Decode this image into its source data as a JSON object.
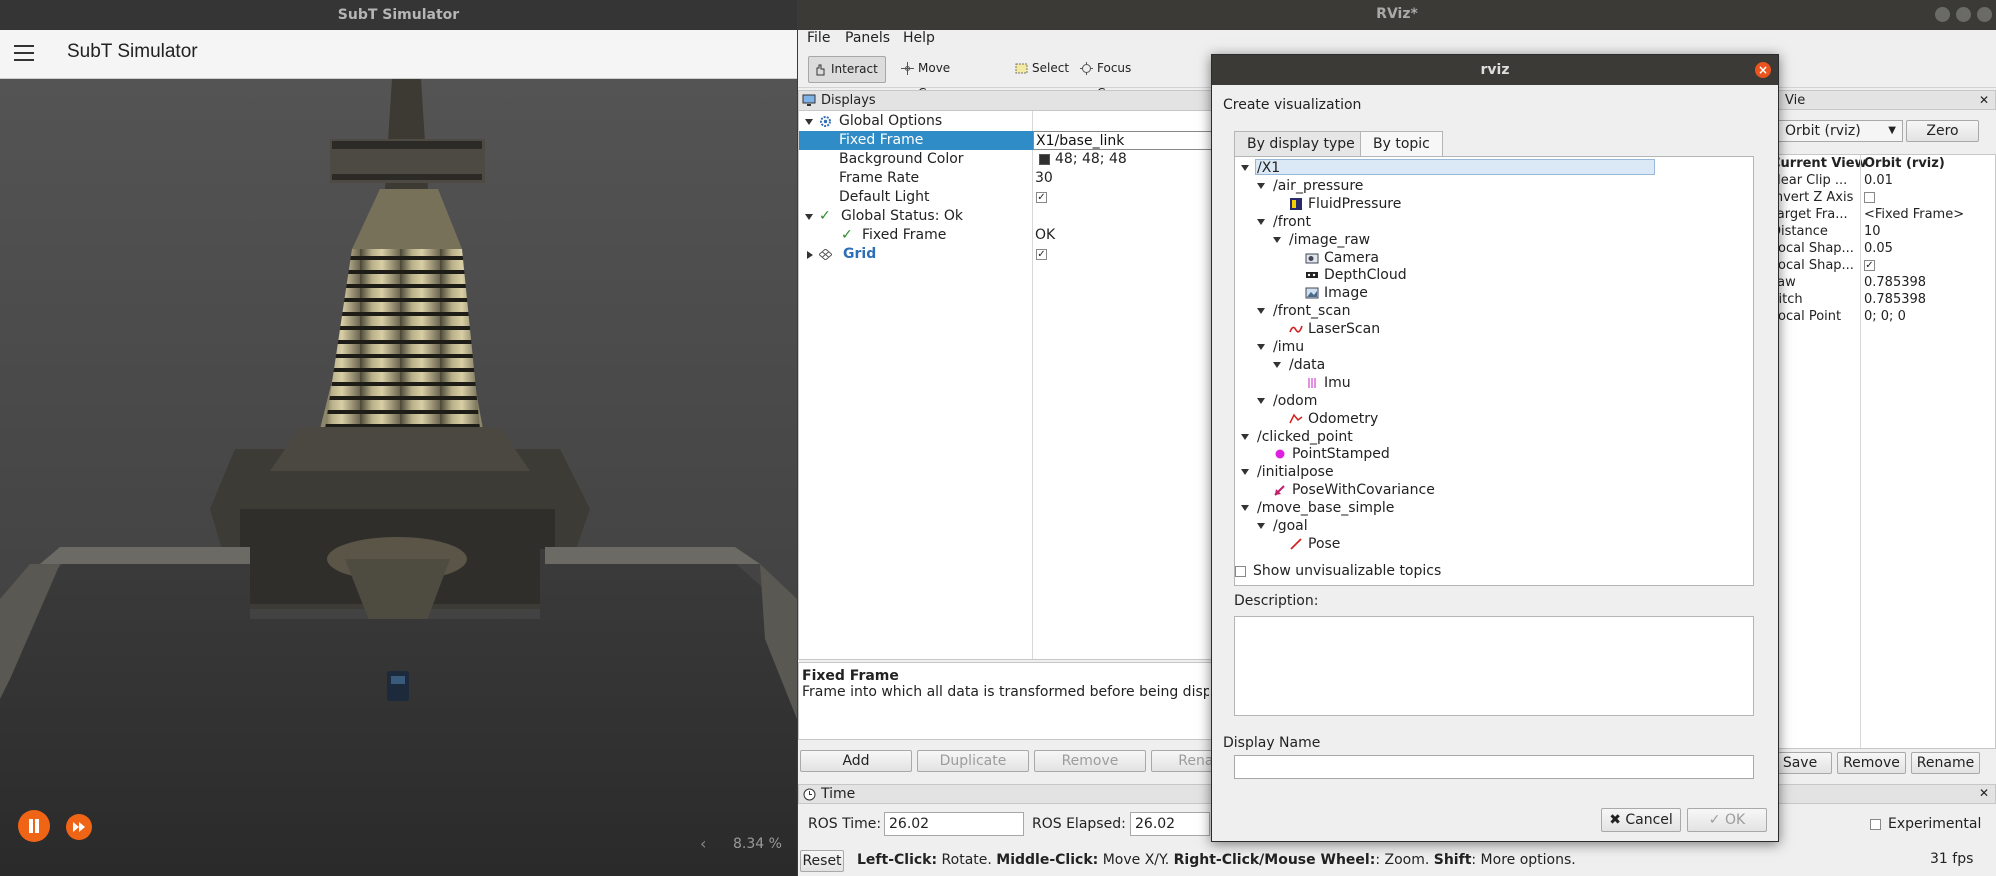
{
  "subt": {
    "window_title": "SubT Simulator",
    "app_title": "SubT Simulator",
    "zoom": "8.34 %",
    "zoom_chevron": "‹",
    "play_icon": "pause-icon",
    "ff_icon": "fast-forward-icon",
    "accent": "#f06416"
  },
  "rviz": {
    "window_title": "RViz*",
    "menu": [
      "File",
      "Panels",
      "Help"
    ],
    "toolbar": [
      "Interact",
      "Move Camera",
      "Select",
      "Focus Camera"
    ],
    "displays": {
      "title": "Displays",
      "rows": [
        {
          "label": "Global Options",
          "value": ""
        },
        {
          "label": "Fixed Frame",
          "value": "X1/base_link"
        },
        {
          "label": "Background Color",
          "value": "48; 48; 48"
        },
        {
          "label": "Frame Rate",
          "value": "30"
        },
        {
          "label": "Default Light",
          "value": "✓"
        },
        {
          "label": "Global Status: Ok",
          "value": ""
        },
        {
          "label": "Fixed Frame",
          "value": "OK"
        },
        {
          "label": "Grid",
          "value": "✓"
        }
      ]
    },
    "description": {
      "title": "Fixed Frame",
      "text": "Frame into which all data is transformed before being displayed."
    },
    "buttons": {
      "add": "Add",
      "duplicate": "Duplicate",
      "remove": "Remove",
      "rename": "Rename"
    },
    "views": {
      "title": "Views",
      "type": "Orbit (rviz)",
      "zero": "Zero",
      "header": {
        "k": "Current View",
        "v": "Orbit (rviz)"
      },
      "rows": [
        {
          "k": "Near Clip ...",
          "v": "0.01"
        },
        {
          "k": "Invert Z Axis",
          "v": ""
        },
        {
          "k": "Target Fra...",
          "v": "<Fixed Frame>"
        },
        {
          "k": "Distance",
          "v": "10"
        },
        {
          "k": "Focal Shap...",
          "v": "0.05"
        },
        {
          "k": "Focal Shap...",
          "v": "✓"
        },
        {
          "k": "Yaw",
          "v": "0.785398"
        },
        {
          "k": "Pitch",
          "v": "0.785398"
        },
        {
          "k": "Focal Point",
          "v": "0; 0; 0"
        }
      ],
      "buttons": {
        "save": "Save",
        "remove": "Remove",
        "rename": "Rename"
      }
    },
    "time": {
      "title": "Time",
      "ros_time_label": "ROS Time:",
      "ros_time": "26.02",
      "ros_elapsed_label": "ROS Elapsed:",
      "ros_elapsed": "26.02",
      "experimental": "Experimental",
      "reset": "Reset",
      "help_left_click": "Left-Click:",
      "help_rotate": " Rotate. ",
      "help_middle": "Middle-Click:",
      "help_move": " Move X/Y. ",
      "help_right": "Right-Click/Mouse Wheel:",
      "help_zoom": ": Zoom. ",
      "help_shift": "Shift",
      "help_more": ": More options.",
      "fps": "31 fps"
    }
  },
  "dialog": {
    "title": "rviz",
    "heading": "Create visualization",
    "tabs": [
      "By display type",
      "By topic"
    ],
    "tree": [
      {
        "depth": 0,
        "label": "/X1",
        "kind": "topic",
        "expanded": true
      },
      {
        "depth": 1,
        "label": "/air_pressure",
        "kind": "topic",
        "expanded": true
      },
      {
        "depth": 2,
        "label": "FluidPressure",
        "kind": "display",
        "icon": "fluid-pressure-icon"
      },
      {
        "depth": 1,
        "label": "/front",
        "kind": "topic",
        "expanded": true
      },
      {
        "depth": 2,
        "label": "/image_raw",
        "kind": "topic",
        "expanded": true
      },
      {
        "depth": 3,
        "label": "Camera",
        "kind": "display",
        "icon": "camera-icon"
      },
      {
        "depth": 3,
        "label": "DepthCloud",
        "kind": "display",
        "icon": "depth-cloud-icon"
      },
      {
        "depth": 3,
        "label": "Image",
        "kind": "display",
        "icon": "image-icon"
      },
      {
        "depth": 1,
        "label": "/front_scan",
        "kind": "topic",
        "expanded": true
      },
      {
        "depth": 2,
        "label": "LaserScan",
        "kind": "display",
        "icon": "laser-scan-icon"
      },
      {
        "depth": 1,
        "label": "/imu",
        "kind": "topic",
        "expanded": true
      },
      {
        "depth": 2,
        "label": "/data",
        "kind": "topic",
        "expanded": true
      },
      {
        "depth": 3,
        "label": "Imu",
        "kind": "display",
        "icon": "imu-icon"
      },
      {
        "depth": 1,
        "label": "/odom",
        "kind": "topic",
        "expanded": true
      },
      {
        "depth": 2,
        "label": "Odometry",
        "kind": "display",
        "icon": "odometry-icon"
      },
      {
        "depth": 0,
        "label": "/clicked_point",
        "kind": "topic",
        "expanded": true
      },
      {
        "depth": 1,
        "label": "PointStamped",
        "kind": "display",
        "icon": "point-stamped-icon"
      },
      {
        "depth": 0,
        "label": "/initialpose",
        "kind": "topic",
        "expanded": true
      },
      {
        "depth": 1,
        "label": "PoseWithCovariance",
        "kind": "display",
        "icon": "pose-covariance-icon"
      },
      {
        "depth": 0,
        "label": "/move_base_simple",
        "kind": "topic",
        "expanded": true
      },
      {
        "depth": 1,
        "label": "/goal",
        "kind": "topic",
        "expanded": true
      },
      {
        "depth": 2,
        "label": "Pose",
        "kind": "display",
        "icon": "pose-icon"
      }
    ],
    "show_unvisualizable": "Show unvisualizable topics",
    "description_label": "Description:",
    "display_name_label": "Display Name",
    "display_name_value": "",
    "cancel": "Cancel",
    "ok": "OK"
  }
}
